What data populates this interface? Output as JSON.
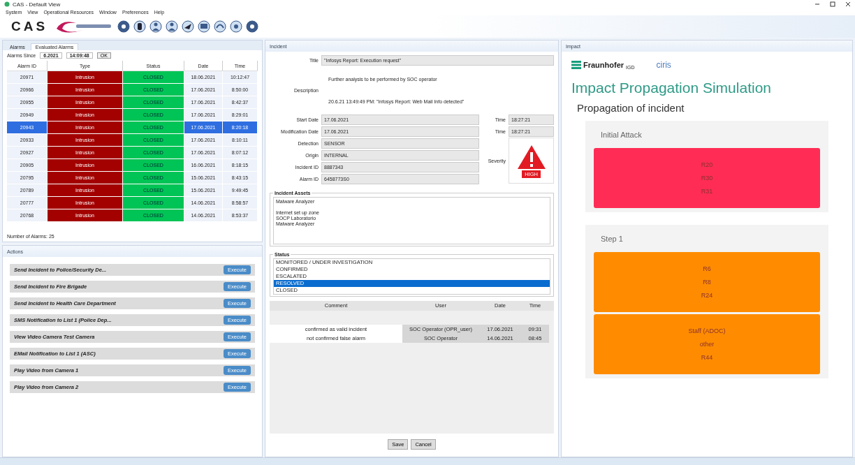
{
  "window": {
    "title": "CAS - Default View"
  },
  "menu": [
    "System",
    "View",
    "Operational Resources",
    "Window",
    "Preferences",
    "Help"
  ],
  "logo": {
    "text": "CAS"
  },
  "alarms_panel": {
    "tabs": [
      {
        "label": "Alarms",
        "selected": false
      },
      {
        "label": "Evaluated Alarms",
        "selected": true
      }
    ],
    "filter": {
      "label": "Alarms Since",
      "date": "6.2021",
      "time": "14:09:48",
      "button": "OK"
    },
    "columns": [
      "Alarm ID",
      "Type",
      "Status",
      "Date",
      "Time"
    ],
    "rows": [
      {
        "cells": [
          "20971",
          "Intrusion",
          "CLOSED",
          "18.06.2021",
          "10:12:47"
        ],
        "selected": false
      },
      {
        "cells": [
          "20966",
          "Intrusion",
          "CLOSED",
          "17.06.2021",
          "8:50:00"
        ],
        "selected": false
      },
      {
        "cells": [
          "20955",
          "Intrusion",
          "CLOSED",
          "17.06.2021",
          "8:42:37"
        ],
        "selected": false
      },
      {
        "cells": [
          "20949",
          "Intrusion",
          "CLOSED",
          "17.06.2021",
          "8:29:01"
        ],
        "selected": false
      },
      {
        "cells": [
          "20943",
          "Intrusion",
          "CLOSED",
          "17.06.2021",
          "8:20:18"
        ],
        "selected": true
      },
      {
        "cells": [
          "20933",
          "Intrusion",
          "CLOSED",
          "17.06.2021",
          "8:10:11"
        ],
        "selected": false
      },
      {
        "cells": [
          "20927",
          "Intrusion",
          "CLOSED",
          "17.06.2021",
          "8:07:12"
        ],
        "selected": false
      },
      {
        "cells": [
          "20905",
          "Intrusion",
          "CLOSED",
          "16.06.2021",
          "8:18:15"
        ],
        "selected": false
      },
      {
        "cells": [
          "20795",
          "Intrusion",
          "CLOSED",
          "15.06.2021",
          "8:43:15"
        ],
        "selected": false
      },
      {
        "cells": [
          "20789",
          "Intrusion",
          "CLOSED",
          "15.06.2021",
          "9:49:45"
        ],
        "selected": false
      },
      {
        "cells": [
          "20777",
          "Intrusion",
          "CLOSED",
          "14.06.2021",
          "8:58:57"
        ],
        "selected": false
      },
      {
        "cells": [
          "20768",
          "Intrusion",
          "CLOSED",
          "14.06.2021",
          "8:53:37"
        ],
        "selected": false
      }
    ],
    "footer": "Number of Alarms: 25"
  },
  "actions_panel": {
    "title": "Actions",
    "items": [
      {
        "label": "Send Incident to Police/Security De...",
        "button": "Execute"
      },
      {
        "label": "Send Incident to Fire Brigade",
        "button": "Execute"
      },
      {
        "label": "Send Incident to Health Care Department",
        "button": "Execute"
      },
      {
        "label": "SMS Notification to List 1 (Police Dep...",
        "button": "Execute"
      },
      {
        "label": "View Video Camera Test Camera",
        "button": "Execute"
      },
      {
        "label": "EMail Notification to List 1 (ASC)",
        "button": "Execute"
      },
      {
        "label": "Play Video from Camera 1",
        "button": "Execute"
      },
      {
        "label": "Play Video from Camera 2",
        "button": "Execute"
      }
    ]
  },
  "incident_panel": {
    "title": "Incident",
    "title_field": {
      "label": "Title",
      "value": "\"Infosys Report: Execution request\""
    },
    "description": {
      "label": "Description",
      "lines": [
        "Further analysis to be performed by SOC operator",
        "20.6.21 13:49:49 PM: \"Infosys Report: Web Mail Info detected\""
      ]
    },
    "fields": [
      {
        "label": "Start Date",
        "value": "17.06.2021"
      },
      {
        "label": "Modification Date",
        "value": "17.06.2021"
      },
      {
        "label": "Detection",
        "value": "SENSOR"
      },
      {
        "label": "Origin",
        "value": "INTERNAL"
      },
      {
        "label": "Incident ID",
        "value": "8887343"
      },
      {
        "label": "Alarm ID",
        "value": "6458773S0"
      }
    ],
    "times": [
      {
        "label": "Time",
        "value": "18:27:21"
      },
      {
        "label": "Time",
        "value": "18:27:21"
      }
    ],
    "severity": {
      "label": "Severity",
      "level_text": "HIGH"
    },
    "assets": {
      "title": "Incident Assets",
      "lines": [
        "Malware Analyzer",
        "Internet set up zone",
        "SOCP Laboratorio",
        "Malware Analyzer"
      ]
    },
    "status": {
      "title": "Status",
      "options": [
        {
          "label": "MONITORED / UNDER INVESTIGATION",
          "selected": false
        },
        {
          "label": "CONFIRMED",
          "selected": false
        },
        {
          "label": "ESCALATED",
          "selected": false
        },
        {
          "label": "RESOLVED",
          "selected": true
        },
        {
          "label": "CLOSED",
          "selected": false
        }
      ]
    },
    "comments": {
      "columns": [
        "Comment",
        "User",
        "Date",
        "Time"
      ],
      "rows": [
        [
          "confirmed as valid incident",
          "SOC Operator (OPR_user)",
          "17.06.2021",
          "09:31"
        ],
        [
          "not confirmed false alarm",
          "SOC Operator",
          "14.06.2021",
          "08:45"
        ]
      ]
    },
    "buttons": [
      "Save",
      "Cancel"
    ]
  },
  "impact_panel": {
    "tab": "Impact",
    "org": "Fraunhofer",
    "org_sub": "IGD",
    "partner": "ciris",
    "title": "Impact Propagation Simulation",
    "subtitle": "Propagation of incident",
    "steps": [
      {
        "title": "Initial Attack",
        "color": "#ff2d55",
        "blocks": [
          [
            "R20",
            "R30",
            "R31"
          ]
        ]
      },
      {
        "title": "Step 1",
        "color": "#ff8c00",
        "blocks": [
          [
            "R6",
            "R8",
            "R24"
          ],
          [
            "Staff (ADOC)",
            "other",
            "R44"
          ]
        ]
      }
    ]
  }
}
